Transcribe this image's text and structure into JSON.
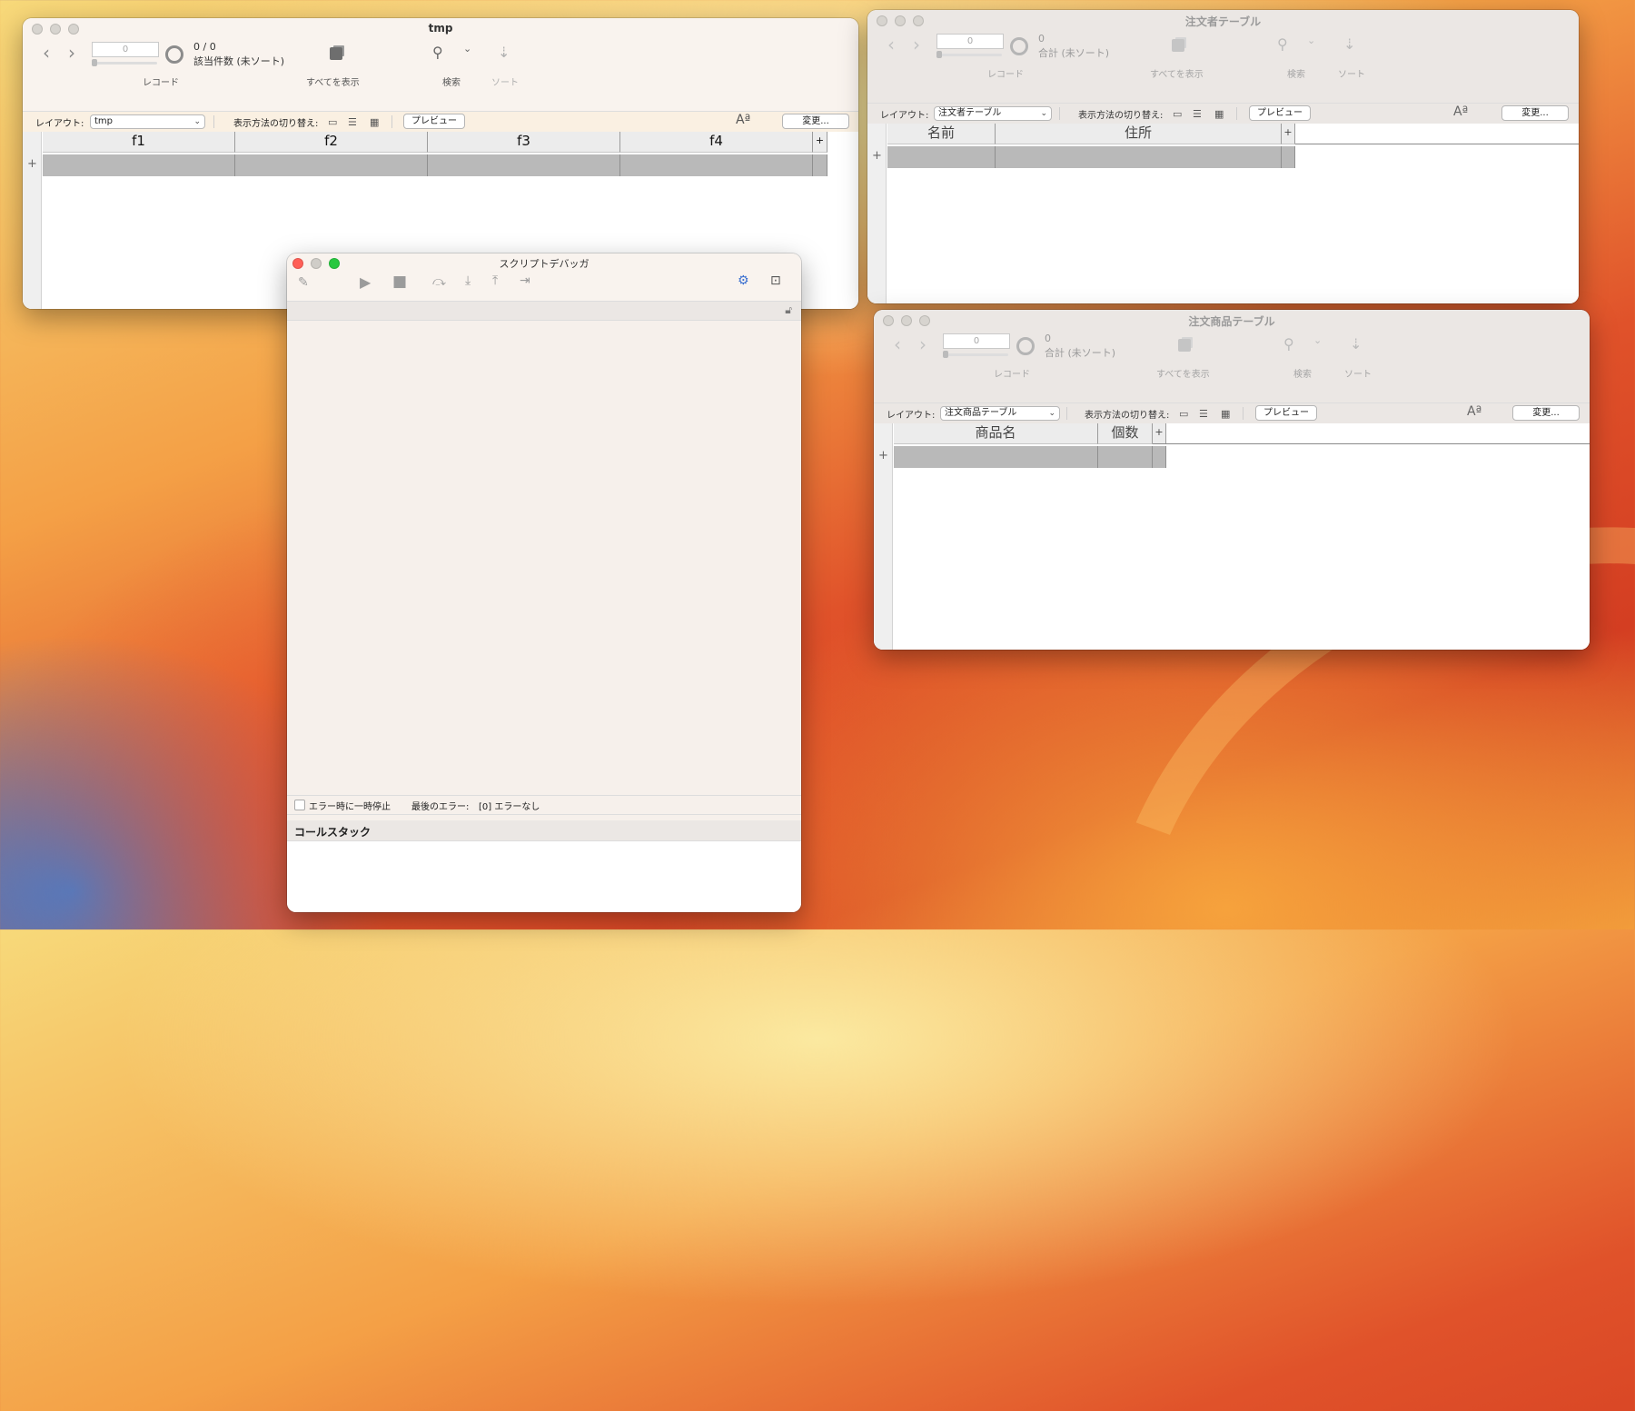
{
  "tmp_window": {
    "title": "tmp",
    "record_field": "0",
    "count": "0 / 0",
    "sort_status": "該当件数 (未ソート)",
    "label_records": "レコード",
    "label_show_all": "すべてを表示",
    "label_search": "検索",
    "label_sort": "ソート",
    "layout_label": "レイアウト:",
    "layout_value": "tmp",
    "view_switch_label": "表示方法の切り替え:",
    "preview_label": "プレビュー",
    "change_label": "変更...",
    "font_icon_label": "Aª",
    "columns": [
      "f1",
      "f2",
      "f3",
      "f4"
    ]
  },
  "orderer_window": {
    "title": "注文者テーブル",
    "record_field": "0",
    "count": "0",
    "sort_status": "合計 (未ソート)",
    "label_records": "レコード",
    "label_show_all": "すべてを表示",
    "label_search": "検索",
    "label_sort": "ソート",
    "layout_label": "レイアウト:",
    "layout_value": "注文者テーブル",
    "view_switch_label": "表示方法の切り替え:",
    "preview_label": "プレビュー",
    "change_label": "変更...",
    "font_icon_label": "Aª",
    "columns": [
      "名前",
      "住所"
    ]
  },
  "items_window": {
    "title": "注文商品テーブル",
    "record_field": "0",
    "count": "0",
    "sort_status": "合計 (未ソート)",
    "label_records": "レコード",
    "label_show_all": "すべてを表示",
    "label_search": "検索",
    "label_sort": "ソート",
    "layout_label": "レイアウト:",
    "layout_value": "注文商品テーブル",
    "view_switch_label": "表示方法の切り替え:",
    "preview_label": "プレビュー",
    "change_label": "変更...",
    "font_icon_label": "Aª",
    "columns": [
      "商品名",
      "個数"
    ]
  },
  "debugger": {
    "title": "スクリプトデバッガ",
    "pause_on_error": "エラー時に一時停止",
    "last_error_label": "最後のエラー:",
    "last_error_value": "[0] エラーなし",
    "call_stack_label": "コールスタック"
  },
  "colors": {
    "fm_accent": "#faf0e2",
    "close_red": "#ff5f57",
    "zoom_green": "#28c840"
  }
}
